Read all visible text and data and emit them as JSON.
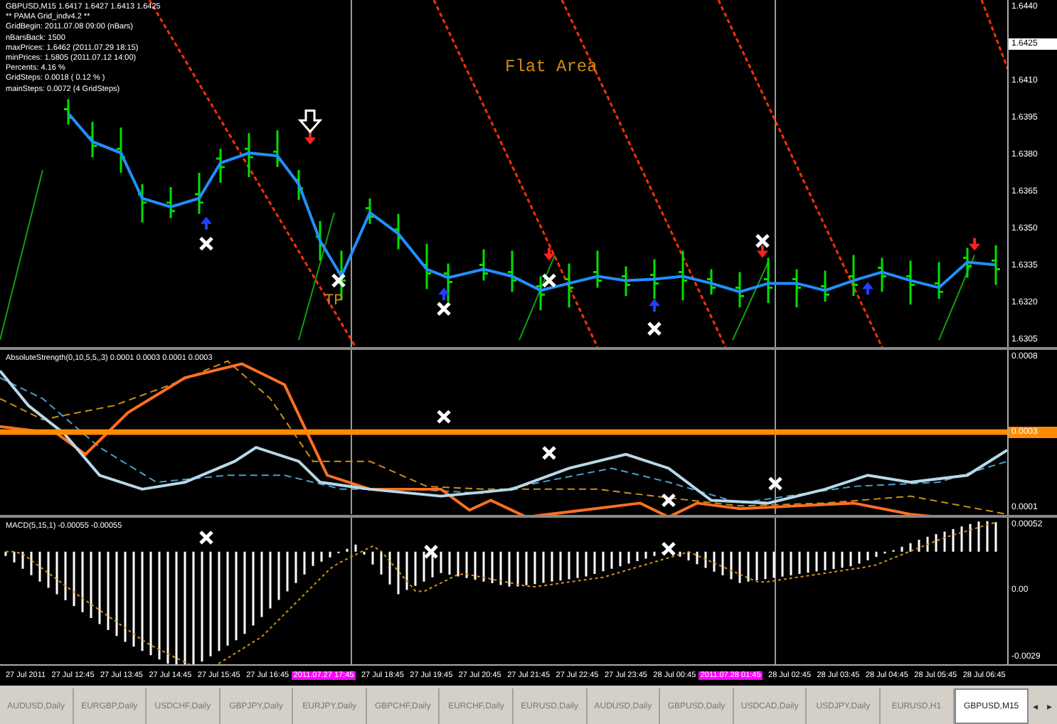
{
  "chart": {
    "info_lines": [
      "GBPUSD,M15  1.6417 1.6427 1.6413 1.6425",
      "** PAMA Grid_indv4.2 **",
      "GridBegin: 2011.07.08 09:00  (nBars)",
      "nBarsBack: 1500",
      "maxPrices: 1.6462  (2011.07.29 18:15)",
      "minPrices: 1.5805  (2011.07.12 14:00)",
      "Percents: 4.16 %",
      "GridSteps: 0.0018  ( 0.12 % )",
      "mainSteps: 0.0072  (4 GridSteps)"
    ],
    "annotations": [
      {
        "text": "Flat Area",
        "kind": "area"
      },
      {
        "text": "TP",
        "kind": "tp"
      }
    ],
    "axis": [
      {
        "label": "1.6440",
        "kind": "tick"
      },
      {
        "label": "1.6425",
        "kind": "price"
      },
      {
        "label": "1.6410",
        "kind": "tick"
      },
      {
        "label": "1.6395",
        "kind": "tick"
      },
      {
        "label": "1.6380",
        "kind": "tick"
      },
      {
        "label": "1.6365",
        "kind": "tick"
      },
      {
        "label": "1.6350",
        "kind": "tick"
      },
      {
        "label": "1.6335",
        "kind": "tick"
      },
      {
        "label": "1.6320",
        "kind": "tick"
      },
      {
        "label": "1.6305",
        "kind": "tick"
      }
    ]
  },
  "indicator": {
    "label": "AbsoluteStrength(0,10,5,5,,3) 0.0001 0.0003 0.0001 0.0003",
    "axis": [
      {
        "label": "0.0008",
        "kind": "tick"
      },
      {
        "label": "0.0003",
        "kind": "level"
      },
      {
        "label": "0.0001",
        "kind": "tick"
      }
    ]
  },
  "macd": {
    "label": "MACD(5,15,1) -0.00055 -0.00055",
    "axis": [
      "0.00052",
      "0.00",
      "-0.0029"
    ]
  },
  "time_axis": [
    {
      "label": "27 Jul 2011",
      "kind": "tick"
    },
    {
      "label": "27 Jul 12:45",
      "kind": "tick"
    },
    {
      "label": "27 Jul 13:45",
      "kind": "tick"
    },
    {
      "label": "27 Jul 14:45",
      "kind": "tick"
    },
    {
      "label": "27 Jul 15:45",
      "kind": "tick"
    },
    {
      "label": "27 Jul 16:45",
      "kind": "tick"
    },
    {
      "label": "2011.07.27 17:45",
      "kind": "cursor"
    },
    {
      "label": "27 Jul 18:45",
      "kind": "tick"
    },
    {
      "label": "27 Jul 19:45",
      "kind": "tick"
    },
    {
      "label": "27 Jul 20:45",
      "kind": "tick"
    },
    {
      "label": "27 Jul 21:45",
      "kind": "tick"
    },
    {
      "label": "27 Jul 22:45",
      "kind": "tick"
    },
    {
      "label": "27 Jul 23:45",
      "kind": "tick"
    },
    {
      "label": "28 Jul 00:45",
      "kind": "tick"
    },
    {
      "label": "2011.07.28 01:45",
      "kind": "cursor"
    },
    {
      "label": "28 Jul 02:45",
      "kind": "tick"
    },
    {
      "label": "28 Jul 03:45",
      "kind": "tick"
    },
    {
      "label": "28 Jul 04:45",
      "kind": "tick"
    },
    {
      "label": "28 Jul 05:45",
      "kind": "tick"
    },
    {
      "label": "28 Jul 06:45",
      "kind": "tick"
    }
  ],
  "tabs": [
    {
      "label": "AUDUSD,Daily",
      "selected": false
    },
    {
      "label": "EURGBP,Daily",
      "selected": false
    },
    {
      "label": "USDCHF,Daily",
      "selected": false
    },
    {
      "label": "GBPJPY,Daily",
      "selected": false
    },
    {
      "label": "EURJPY,Daily",
      "selected": false
    },
    {
      "label": "GBPCHF,Daily",
      "selected": false
    },
    {
      "label": "EURCHF,Daily",
      "selected": false
    },
    {
      "label": "EURUSD,Daily",
      "selected": false
    },
    {
      "label": "AUDUSD,Daily",
      "selected": false
    },
    {
      "label": "GBPUSD,Daily",
      "selected": false
    },
    {
      "label": "USDCAD,Daily",
      "selected": false
    },
    {
      "label": "USDJPY,Daily",
      "selected": false
    },
    {
      "label": "EURUSD,H1",
      "selected": false
    },
    {
      "label": "GBPUSD,M15",
      "selected": true
    }
  ],
  "tab_scroll": [
    "◂",
    "▸"
  ]
}
